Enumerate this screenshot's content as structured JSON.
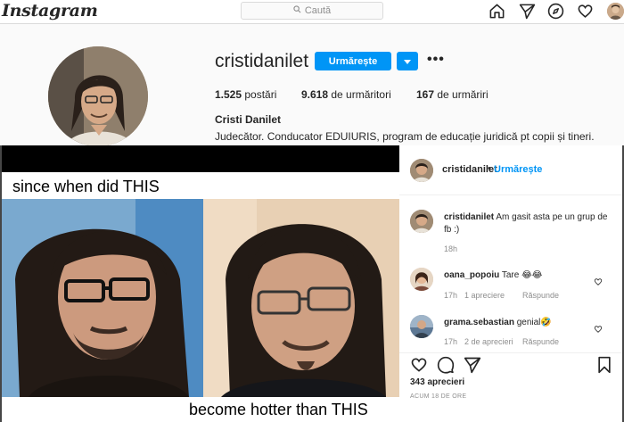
{
  "topbar": {
    "logo": "Instagram",
    "search_placeholder": "Caută",
    "icons": [
      "home-icon",
      "direct-icon",
      "explore-icon",
      "activity-heart-icon",
      "profile-avatar"
    ]
  },
  "profile": {
    "username": "cristidanilet",
    "follow_label": "Urmărește",
    "more_icon": "•••",
    "posts_count": "1.525",
    "posts_label": "postări",
    "followers_count": "9.618",
    "followers_label": "de urmăritori",
    "following_count": "167",
    "following_label": "de urmăriri",
    "full_name": "Cristi Danilet",
    "bio": "Judecător. Conducator EDUIURIS, program de educație juridică pt copii și tineri."
  },
  "post": {
    "meme_top_caption": "since when did THIS",
    "meme_bottom_caption": "become hotter than THIS",
    "author": "cristidanilet",
    "header_follow": "Urmărește",
    "caption": "Am gasit asta pe un grup de fb :)",
    "caption_time": "18h",
    "comments": [
      {
        "user": "oana_popoiu",
        "text": "Tare 😂😂",
        "time": "17h",
        "likes": "1 apreciere",
        "reply": "Răspunde"
      },
      {
        "user": "grama.sebastian",
        "text": "genial🤣",
        "time": "17h",
        "likes": "2 de aprecieri",
        "reply": "Răspunde"
      }
    ],
    "likes": "343 aprecieri",
    "posted_ago": "ACUM 18 DE ORE"
  },
  "colors": {
    "accent": "#0095f6",
    "text": "#262626",
    "muted": "#8e8e8e",
    "overlay": "rgba(0,0,0,0.72)"
  }
}
